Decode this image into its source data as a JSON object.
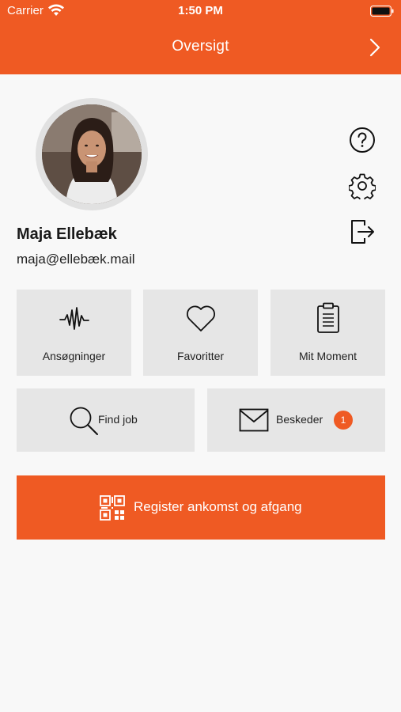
{
  "status_bar": {
    "carrier": "Carrier",
    "time": "1:50 PM"
  },
  "header": {
    "title": "Oversigt",
    "next_icon": "chevron-right-icon"
  },
  "profile": {
    "name": "Maja Ellebæk",
    "email": "maja@ellebæk.mail"
  },
  "side_actions": [
    {
      "icon": "help-icon"
    },
    {
      "icon": "gear-icon"
    },
    {
      "icon": "logout-icon"
    }
  ],
  "tiles": {
    "applications": {
      "label": "Ansøgninger",
      "icon": "pulse-icon"
    },
    "favorites": {
      "label": "Favoritter",
      "icon": "heart-icon"
    },
    "my_moment": {
      "label": "Mit Moment",
      "icon": "clipboard-icon"
    },
    "find_job": {
      "label": "Find job",
      "icon": "search-icon"
    },
    "messages": {
      "label": "Beskeder",
      "icon": "envelope-icon",
      "badge": "1"
    }
  },
  "register": {
    "label": "Register ankomst og afgang",
    "icon": "qr-code-icon"
  },
  "colors": {
    "accent": "#ef5a23",
    "tile": "#e6e6e6",
    "background": "#f8f8f8"
  }
}
